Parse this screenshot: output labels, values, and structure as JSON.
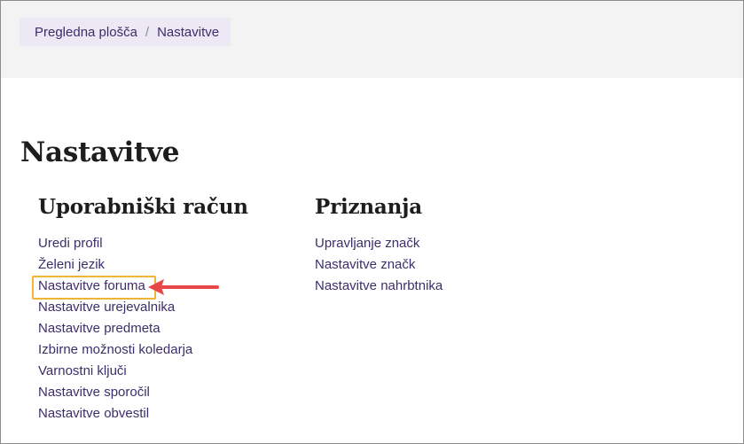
{
  "breadcrumb": {
    "items": [
      {
        "label": "Pregledna plošča"
      },
      {
        "label": "Nastavitve"
      }
    ],
    "separator": "/"
  },
  "page": {
    "title": "Nastavitve"
  },
  "sections": {
    "account": {
      "heading": "Uporabniški račun",
      "links": [
        "Uredi profil",
        "Želeni jezik",
        "Nastavitve foruma",
        "Nastavitve urejevalnika",
        "Nastavitve predmeta",
        "Izbirne možnosti koledarja",
        "Varnostni ključi",
        "Nastavitve sporočil",
        "Nastavitve obvestil"
      ]
    },
    "badges": {
      "heading": "Priznanja",
      "links": [
        "Upravljanje značk",
        "Nastavitve značk",
        "Nastavitve nahrbtnika"
      ]
    }
  },
  "annotation": {
    "highlight_color": "#f2b437",
    "arrow_color": "#e8474a",
    "highlighted_link": "Nastavitve foruma"
  },
  "colors": {
    "link": "#3c2d6b",
    "header_band": "#f3f3f3",
    "breadcrumb_bg": "#ece9f5"
  }
}
